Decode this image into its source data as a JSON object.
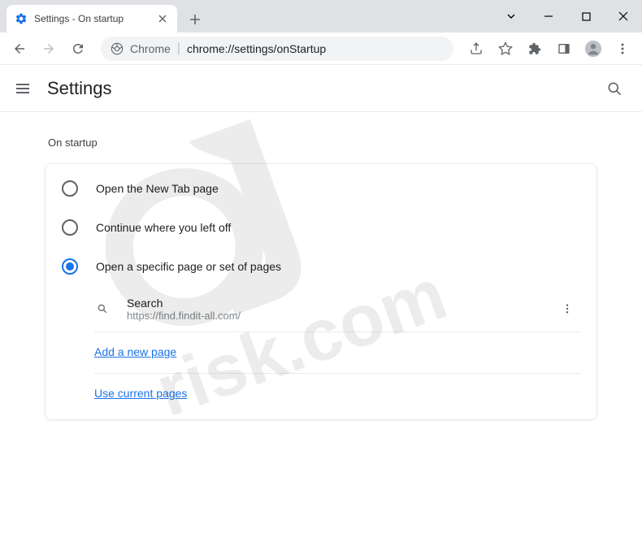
{
  "window": {
    "tab_title": "Settings - On startup"
  },
  "omnibox": {
    "scheme_label": "Chrome",
    "url": "chrome://settings/onStartup"
  },
  "header": {
    "title": "Settings"
  },
  "section": {
    "title": "On startup"
  },
  "options": {
    "new_tab": "Open the New Tab page",
    "continue": "Continue where you left off",
    "specific": "Open a specific page or set of pages"
  },
  "startup_page": {
    "name": "Search",
    "url": "https://find.findit-all.com/"
  },
  "links": {
    "add_page": "Add a new page",
    "use_current": "Use current pages"
  }
}
